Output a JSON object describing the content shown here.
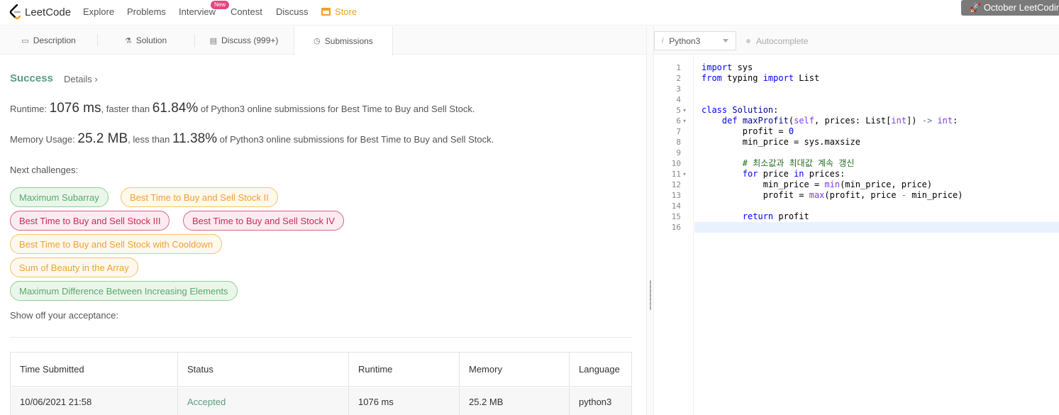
{
  "nav": {
    "logo_text": "LeetCode",
    "items": [
      "Explore",
      "Problems",
      "Interview",
      "Contest",
      "Discuss"
    ],
    "new_badge": "New",
    "store": "Store",
    "promo": "October LeetCoding"
  },
  "tabs": [
    {
      "label": "Description",
      "icon": "description-icon"
    },
    {
      "label": "Solution",
      "icon": "flask-icon"
    },
    {
      "label": "Discuss (999+)",
      "icon": "chat-icon"
    },
    {
      "label": "Submissions",
      "icon": "clock-icon"
    }
  ],
  "result": {
    "status": "Success",
    "details": "Details",
    "runtime_label": "Runtime: ",
    "runtime_value": "1076 ms",
    "runtime_mid": ", faster than ",
    "runtime_pct": "61.84%",
    "runtime_tail": " of Python3 online submissions for Best Time to Buy and Sell Stock.",
    "memory_label": "Memory Usage: ",
    "memory_value": "25.2 MB",
    "memory_mid": ", less than ",
    "memory_pct": "11.38%",
    "memory_tail": " of Python3 online submissions for Best Time to Buy and Sell Stock."
  },
  "next_label": "Next challenges:",
  "challenges": [
    {
      "label": "Maximum Subarray",
      "difficulty": "easy"
    },
    {
      "label": "Best Time to Buy and Sell Stock II",
      "difficulty": "medium"
    },
    {
      "label": "Best Time to Buy and Sell Stock III",
      "difficulty": "hard"
    },
    {
      "label": "Best Time to Buy and Sell Stock IV",
      "difficulty": "hard"
    },
    {
      "label": "Best Time to Buy and Sell Stock with Cooldown",
      "difficulty": "medium"
    },
    {
      "label": "Sum of Beauty in the Array",
      "difficulty": "medium"
    },
    {
      "label": "Maximum Difference Between Increasing Elements",
      "difficulty": "easy"
    }
  ],
  "showoff": "Show off your acceptance:",
  "table": {
    "headers": [
      "Time Submitted",
      "Status",
      "Runtime",
      "Memory",
      "Language"
    ],
    "rows": [
      [
        "10/06/2021 21:58",
        "Accepted",
        "1076 ms",
        "25.2 MB",
        "python3"
      ]
    ]
  },
  "editor": {
    "language": "Python3",
    "autocomplete": "Autocomplete",
    "line_numbers": [
      "1",
      "2",
      "3",
      "4",
      "5",
      "6",
      "7",
      "8",
      "9",
      "10",
      "11",
      "12",
      "13",
      "14",
      "15",
      "16"
    ],
    "folds": [
      "",
      "",
      "",
      "",
      "▾",
      "▾",
      "",
      "",
      "",
      "",
      "▾",
      "",
      "",
      "",
      "",
      ""
    ]
  },
  "colors": {
    "easy": "#59a869",
    "medium": "#eea236",
    "hard": "#c72d57",
    "success": "#5a9d7f",
    "store": "#f0a020"
  }
}
